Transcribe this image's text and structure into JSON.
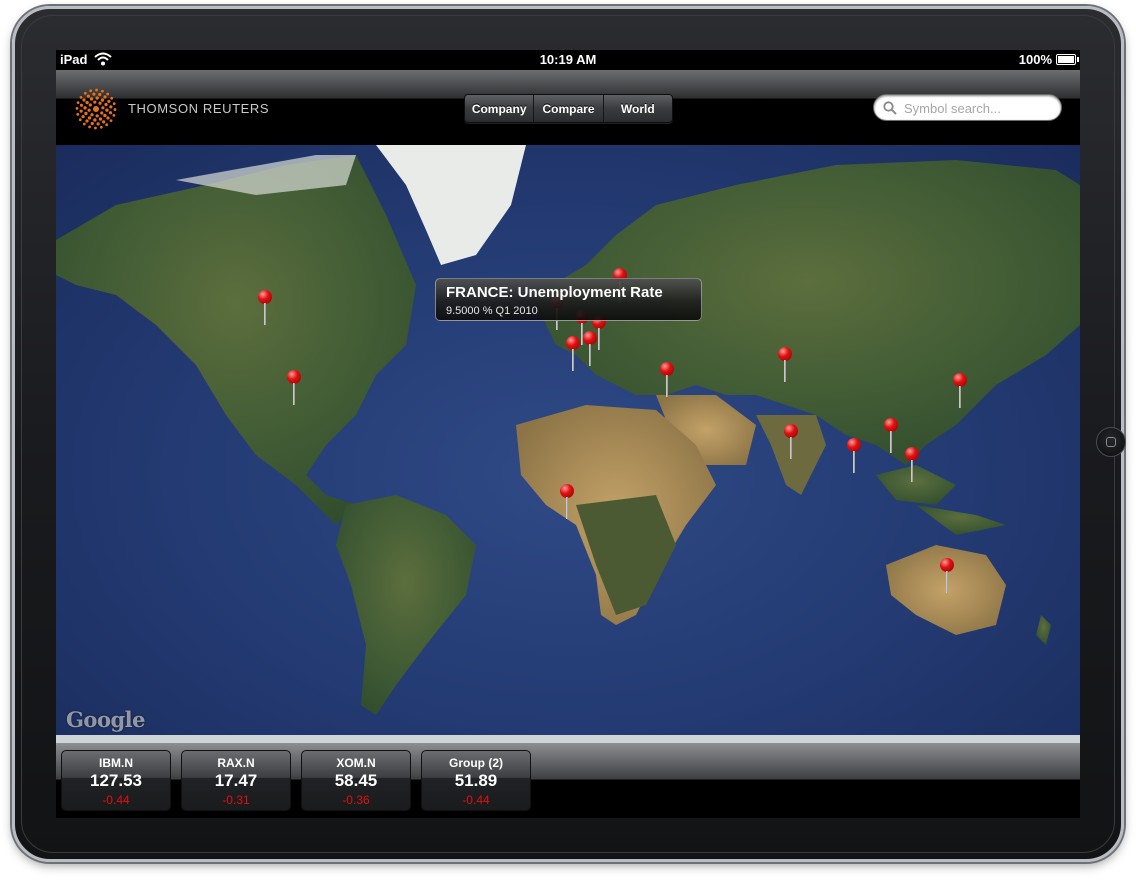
{
  "status_bar": {
    "device_name": "iPad",
    "time": "10:19 AM",
    "battery": "100%"
  },
  "nav": {
    "brand": "THOMSON REUTERS",
    "tabs": [
      {
        "label": "Company"
      },
      {
        "label": "Compare"
      },
      {
        "label": "World"
      }
    ],
    "search_placeholder": "Symbol search..."
  },
  "map": {
    "attribution": "Google",
    "callout": {
      "title": "FRANCE: Unemployment Rate",
      "subtitle": "9.5000 % Q1 2010"
    },
    "pin_color": "#e01010",
    "pin_count": 21
  },
  "tickers": [
    {
      "symbol": "IBM.N",
      "price": "127.53",
      "change": "-0.44"
    },
    {
      "symbol": "RAX.N",
      "price": "17.47",
      "change": "-0.31"
    },
    {
      "symbol": "XOM.N",
      "price": "58.45",
      "change": "-0.36"
    },
    {
      "symbol": "Group (2)",
      "price": "51.89",
      "change": "-0.44"
    }
  ]
}
